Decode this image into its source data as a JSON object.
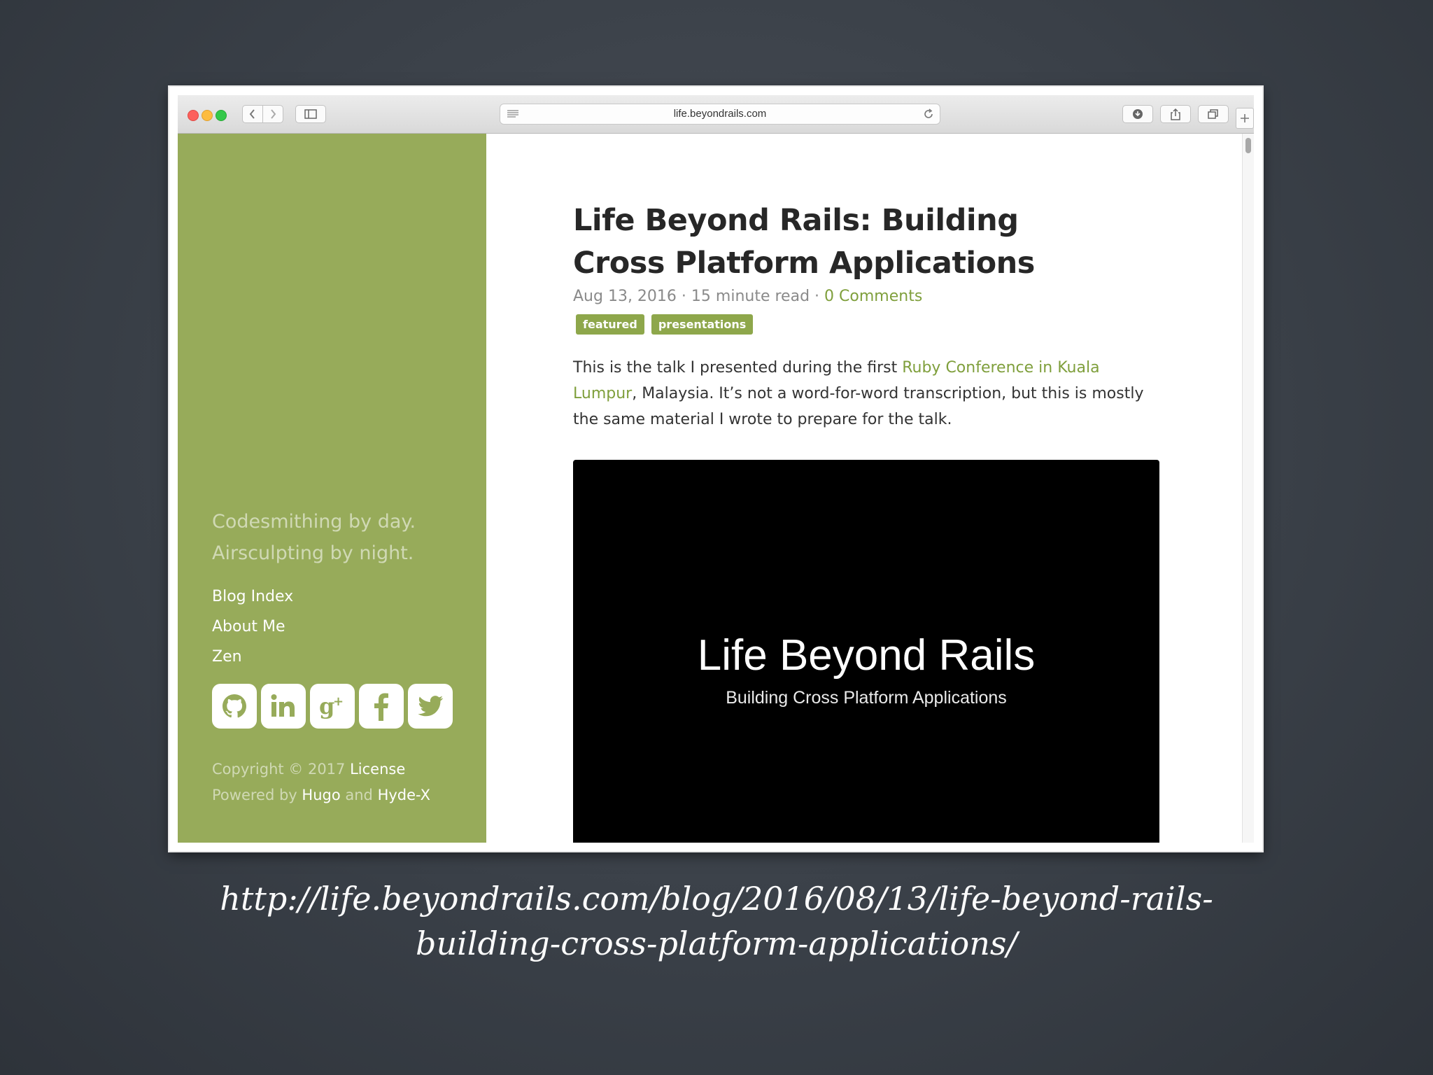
{
  "browser": {
    "url": "life.beyondrails.com",
    "icons": [
      "back-icon",
      "forward-icon",
      "sidebar-icon",
      "reader-icon",
      "reload-icon",
      "download-icon",
      "share-icon",
      "tabs-icon",
      "new-tab-icon"
    ]
  },
  "sidebar": {
    "tagline_line1": "Codesmithing by day.",
    "tagline_line2": "Airsculpting by night.",
    "nav": [
      "Blog Index",
      "About Me",
      "Zen"
    ],
    "social": [
      "github-icon",
      "linkedin-icon",
      "google-plus-icon",
      "facebook-icon",
      "twitter-icon"
    ],
    "footer": {
      "copyright": "Copyright © 2017",
      "license": "License",
      "powered_by": "Powered by",
      "hugo": "Hugo",
      "and": "and",
      "hydex": "Hyde-X"
    }
  },
  "post": {
    "title": "Life Beyond Rails: Building Cross Platform Applications",
    "date": "Aug 13, 2016",
    "read_time": "15 minute read",
    "sep": "·",
    "comments": "0 Comments",
    "tags": [
      "featured",
      "presentations"
    ],
    "intro_before": "This is the talk I presented during the first ",
    "intro_link": "Ruby Conference in Kuala Lumpur",
    "intro_after": ", Malaysia. It’s not a word-for-word transcription, but this is mostly the same material I wrote to prepare for the talk.",
    "video_title": "Life Beyond Rails",
    "video_subtitle": "Building Cross Platform Applications"
  },
  "caption": {
    "line1": "http://life.beyondrails.com/blog/2016/08/13/life-beyond-rails-",
    "line2": "building-cross-platform-applications/"
  },
  "colors": {
    "sidebar": "#97ab5a",
    "link": "#7f9f3c",
    "tag": "#8ea74b",
    "background": "#3a4048"
  }
}
